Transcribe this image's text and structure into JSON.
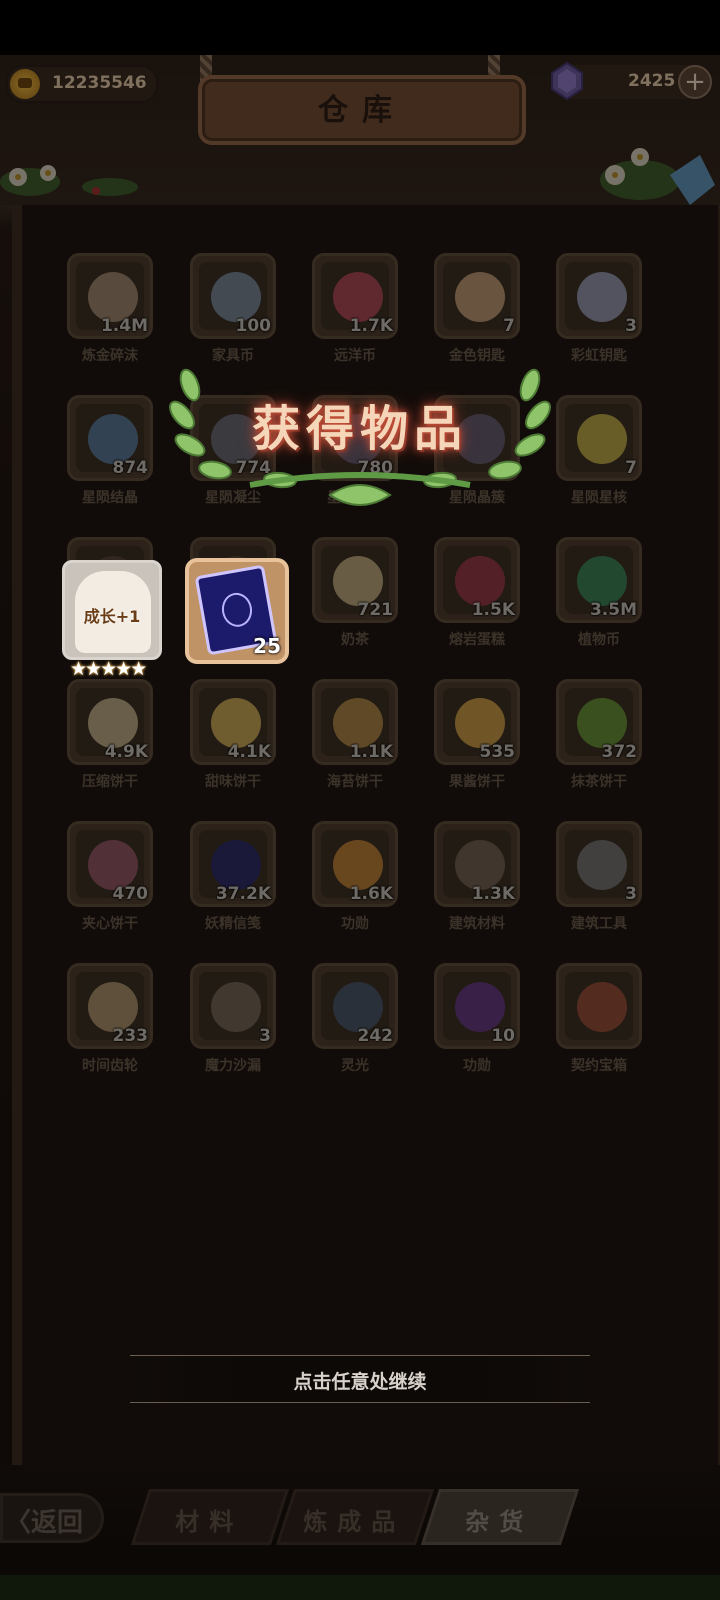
{
  "header": {
    "title": "仓库",
    "coins": "12235546",
    "gems": "2425",
    "plus_label": "+"
  },
  "inventory": [
    {
      "name": "炼金碎沫",
      "count": "1.4M",
      "icon": "alchemy-shards-icon",
      "color": "#a88e74"
    },
    {
      "name": "家具币",
      "count": "100",
      "icon": "furniture-coin-icon",
      "color": "#7e8ea0"
    },
    {
      "name": "远洋币",
      "count": "1.7K",
      "icon": "ocean-coin-icon",
      "color": "#b84a5a"
    },
    {
      "name": "金色钥匙",
      "count": "7",
      "icon": "golden-key-icon",
      "color": "#c8a27a"
    },
    {
      "name": "彩虹钥匙",
      "count": "3",
      "icon": "rainbow-key-icon",
      "color": "#9ba0b8"
    },
    {
      "name": "星陨结晶",
      "count": "874",
      "icon": "star-crystal-icon",
      "color": "#5e7fa0"
    },
    {
      "name": "星陨凝尘",
      "count": "774",
      "icon": "star-dust-icon",
      "color": "#6d6f7a"
    },
    {
      "name": "星陨精华",
      "count": "780",
      "icon": "star-essence-icon",
      "color": "#6a6075"
    },
    {
      "name": "星陨晶簇",
      "count": "",
      "icon": "star-cluster-icon",
      "color": "#6a6075"
    },
    {
      "name": "星陨星核",
      "count": "7",
      "icon": "star-core-icon",
      "color": "#c8b34a"
    },
    {
      "name": "",
      "count": "",
      "icon": "hidden-item-icon",
      "color": "#5a4838"
    },
    {
      "name": "",
      "count": "",
      "icon": "hidden-item-icon",
      "color": "#5a4838"
    },
    {
      "name": "奶茶",
      "count": "721",
      "icon": "milk-tea-icon",
      "color": "#c9b585"
    },
    {
      "name": "熔岩蛋糕",
      "count": "1.5K",
      "icon": "lava-cake-icon",
      "color": "#a0394a"
    },
    {
      "name": "植物币",
      "count": "3.5M",
      "icon": "plant-coin-icon",
      "color": "#3c8a5a"
    },
    {
      "name": "压缩饼干",
      "count": "4.9K",
      "icon": "compressed-biscuit-icon",
      "color": "#c9b68e"
    },
    {
      "name": "甜味饼干",
      "count": "4.1K",
      "icon": "sweet-biscuit-icon",
      "color": "#d8b45a"
    },
    {
      "name": "海苔饼干",
      "count": "1.1K",
      "icon": "seaweed-biscuit-icon",
      "color": "#b88c4a"
    },
    {
      "name": "果酱饼干",
      "count": "535",
      "icon": "jam-biscuit-icon",
      "color": "#d8a44a"
    },
    {
      "name": "抹茶饼干",
      "count": "372",
      "icon": "matcha-biscuit-icon",
      "color": "#6f9a3a"
    },
    {
      "name": "夹心饼干",
      "count": "470",
      "icon": "sandwich-biscuit-icon",
      "color": "#9a5a6a"
    },
    {
      "name": "妖精信笺",
      "count": "37.2K",
      "icon": "fairy-letter-icon",
      "color": "#2d2c6e"
    },
    {
      "name": "功勋",
      "count": "1.6K",
      "icon": "merit-medal-icon",
      "color": "#c9883a"
    },
    {
      "name": "建筑材料",
      "count": "1.3K",
      "icon": "building-material-icon",
      "color": "#7a6656"
    },
    {
      "name": "建筑工具",
      "count": "3",
      "icon": "building-tool-icon",
      "color": "#7a7a7a"
    },
    {
      "name": "时间齿轮",
      "count": "233",
      "icon": "time-gear-icon",
      "color": "#b59a72"
    },
    {
      "name": "魔力沙漏",
      "count": "3",
      "icon": "magic-hourglass-icon",
      "color": "#7a6a5a"
    },
    {
      "name": "灵光",
      "count": "242",
      "icon": "inspiration-icon",
      "color": "#4a5a6e"
    },
    {
      "name": "功勋",
      "count": "10",
      "icon": "purple-medal-icon",
      "color": "#6a3a8a"
    },
    {
      "name": "契约宝箱",
      "count": "",
      "icon": "contract-chest-icon",
      "color": "#a0523a"
    }
  ],
  "reward": {
    "banner_title": "获得物品",
    "item1_label": "成长+1",
    "item1_stars": "★★★★★",
    "item2_count": "25",
    "continue_text": "点击任意处继续"
  },
  "bottom": {
    "back_label": "〈返回",
    "tabs": [
      "材料",
      "炼成品",
      "杂货"
    ],
    "active_tab": 2
  }
}
